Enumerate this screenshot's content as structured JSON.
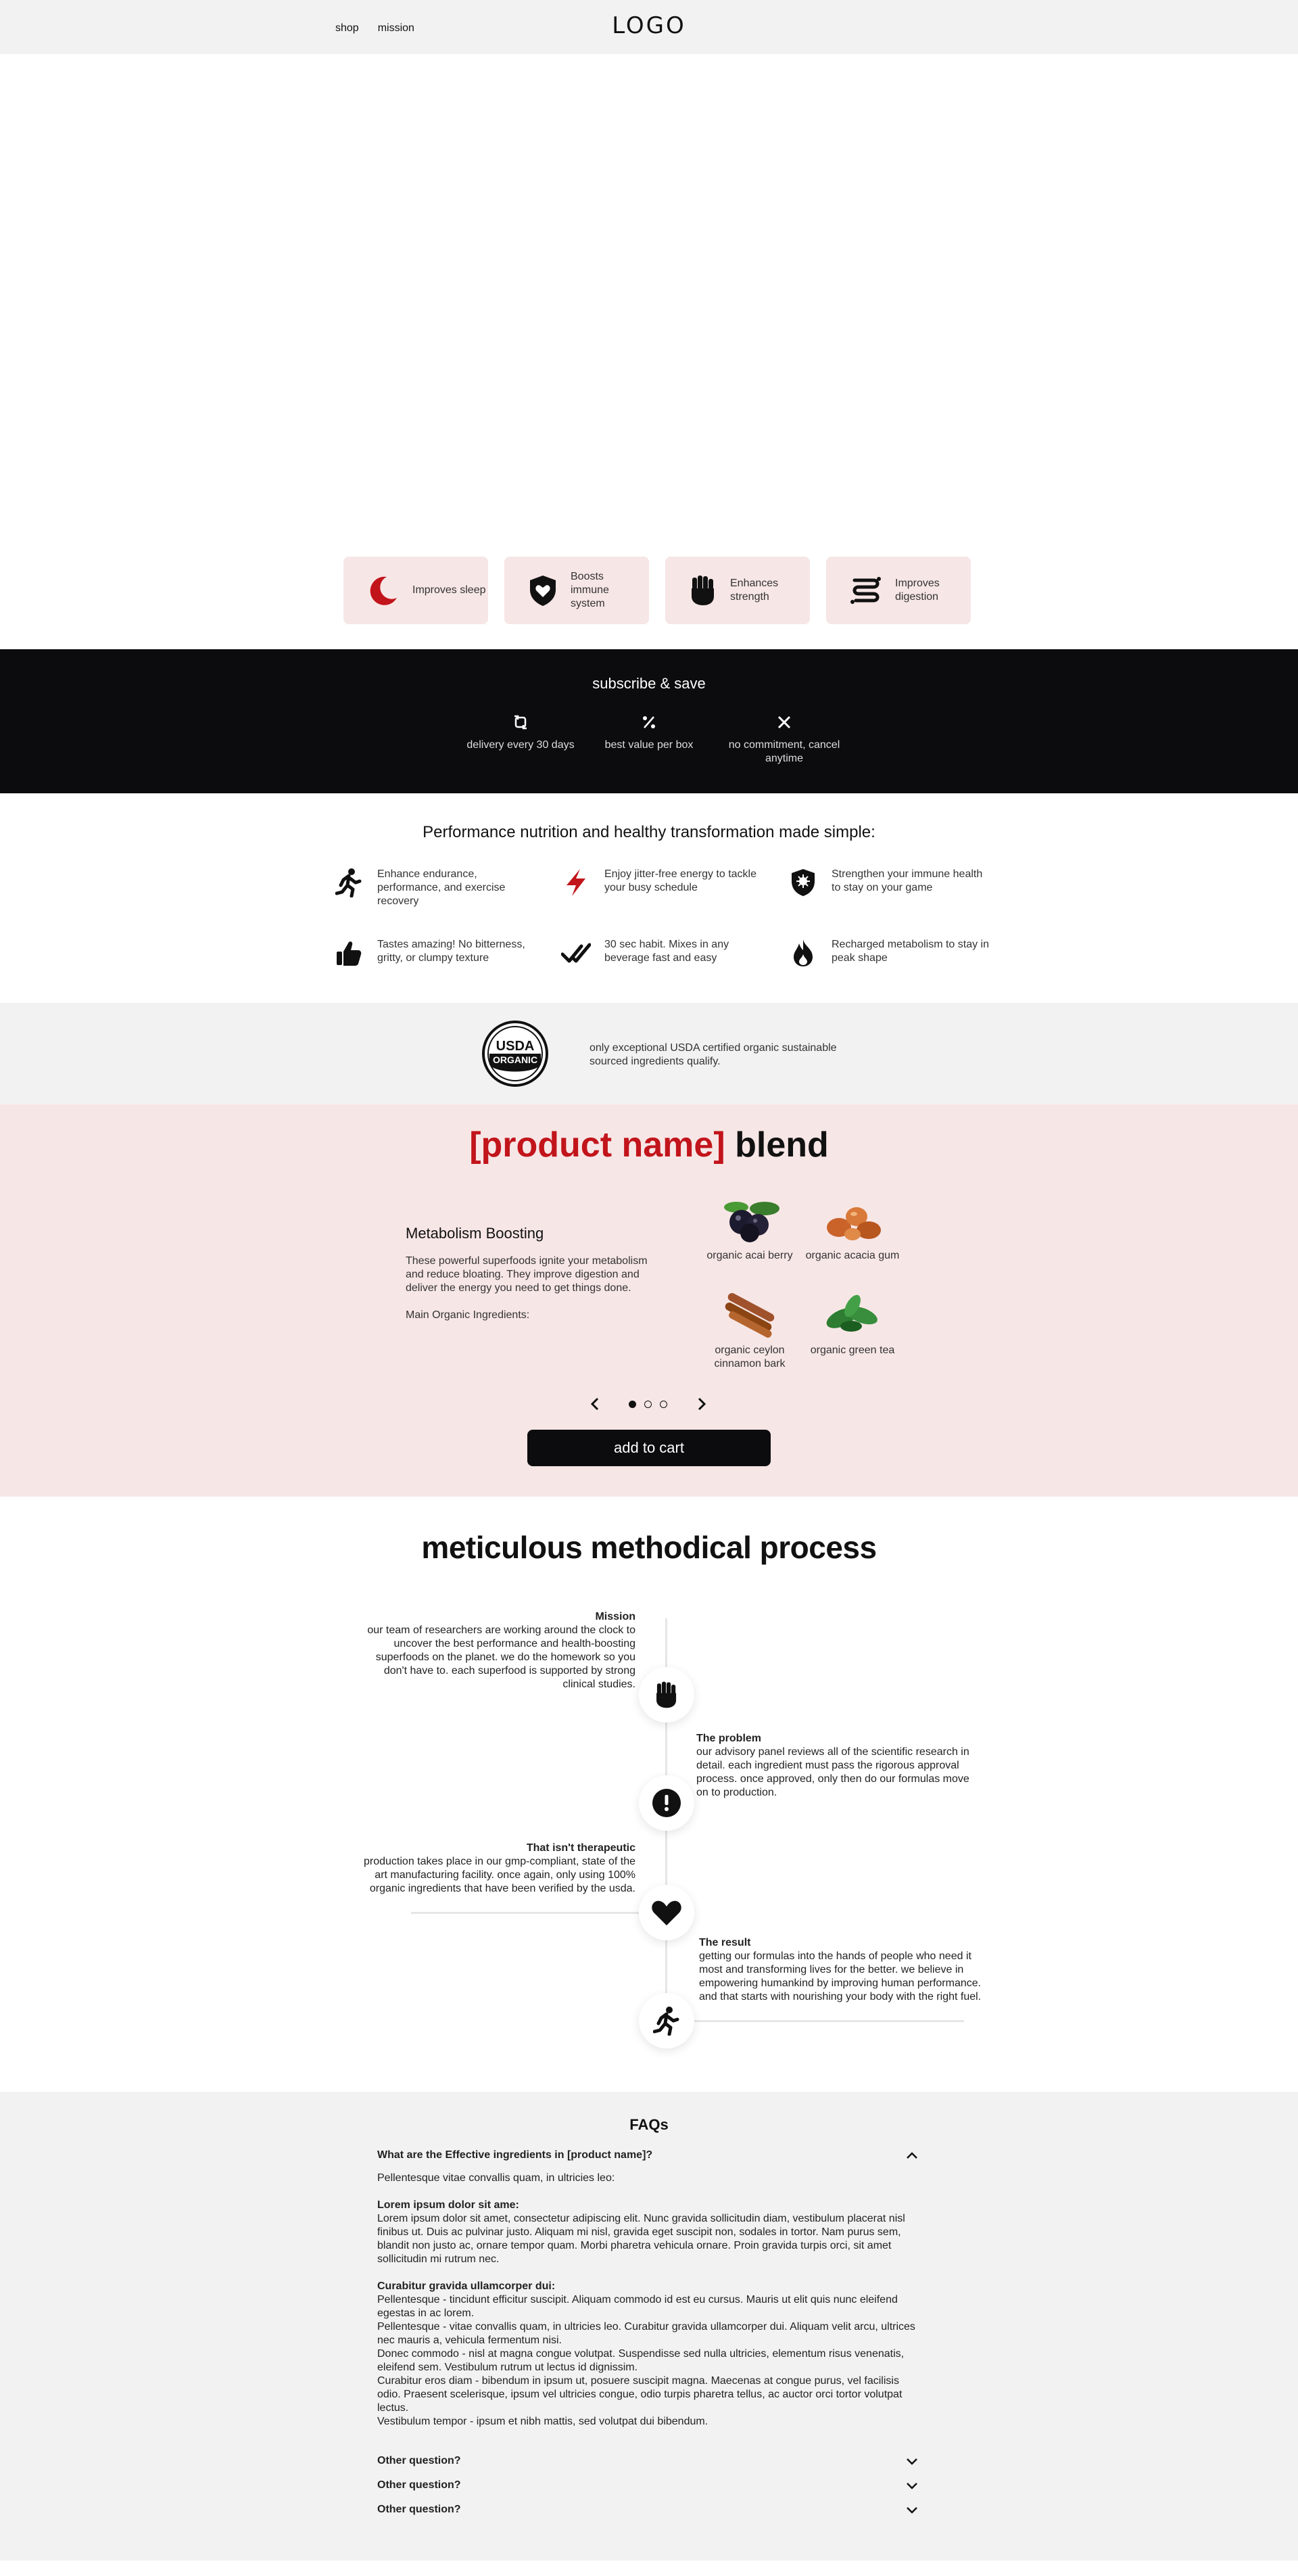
{
  "header": {
    "nav": [
      "shop",
      "mission"
    ],
    "logo": "LOGO"
  },
  "benefits": [
    {
      "icon": "moon-icon",
      "label": "Improves sleep"
    },
    {
      "icon": "shield-heart-icon",
      "label": "Boosts immune system"
    },
    {
      "icon": "fist-icon",
      "label": "Enhances strength"
    },
    {
      "icon": "stomach-icon",
      "label": "Improves digestion"
    }
  ],
  "subscribe": {
    "title": "subscribe & save",
    "items": [
      {
        "icon": "recycle-icon",
        "label": "delivery every 30 days"
      },
      {
        "icon": "percent-icon",
        "label": "best value per box"
      },
      {
        "icon": "close-icon",
        "label": "no commitment, cancel anytime"
      }
    ]
  },
  "performance": {
    "title": "Performance nutrition and healthy transformation made simple:",
    "items": [
      {
        "icon": "running-icon",
        "text": "Enhance endurance, performance, and exercise recovery"
      },
      {
        "icon": "lightning-icon",
        "text": "Enjoy jitter-free energy to tackle your busy schedule"
      },
      {
        "icon": "shield-virus-icon",
        "text": "Strengthen your immune health to stay on your game"
      },
      {
        "icon": "thumbs-up-icon",
        "text": "Tastes amazing! No bitterness, gritty, or clumpy texture"
      },
      {
        "icon": "double-check-icon",
        "text": "30 sec habit. Mixes in any beverage fast and easy"
      },
      {
        "icon": "flame-icon",
        "text": "Recharged metabolism to stay in peak shape"
      }
    ]
  },
  "usda": {
    "seal_top": "USDA",
    "seal_bottom": "ORGANIC",
    "text": "only exceptional USDA certified organic sustainable sourced ingredients qualify."
  },
  "blend": {
    "title_red": "[product name]",
    "title_black": "blend",
    "subtitle": "Metabolism Boosting",
    "description": "These powerful superfoods ignite your metabolism and reduce bloating. They improve digestion and deliver the energy you need to get things done.",
    "ingredients_label": "Main Organic Ingredients:",
    "ingredients": [
      {
        "icon": "acai-berry-icon",
        "label": "organic acai berry"
      },
      {
        "icon": "acacia-gum-icon",
        "label": "organic acacia gum"
      },
      {
        "icon": "cinnamon-icon",
        "label": "organic ceylon cinnamon bark"
      },
      {
        "icon": "green-tea-icon",
        "label": "organic green tea"
      }
    ],
    "add_to_cart": "add to cart"
  },
  "process": {
    "title": "meticulous methodical process",
    "steps": [
      {
        "icon": "fist-icon",
        "title": "Mission",
        "text": "our team of researchers are working around the clock to uncover the best performance and health-boosting superfoods on the planet. we do the homework so you don't have to. each superfood is supported by strong clinical studies."
      },
      {
        "icon": "alert-icon",
        "title": "The problem",
        "text": "our advisory panel reviews all of the scientific research in detail. each ingredient must pass the rigorous approval process. once approved, only then do our formulas move on to production."
      },
      {
        "icon": "heart-icon",
        "title": "That isn't therapeutic",
        "text": "production takes place in our gmp-compliant, state of the art manufacturing facility. once again, only using 100% organic ingredients that have been verified by the usda."
      },
      {
        "icon": "running-icon",
        "title": "The result",
        "text": "getting our formulas into the hands of people who need it most and transforming lives for the better. we believe in empowering humankind by improving human performance. and that starts with nourishing your body with the right fuel."
      }
    ]
  },
  "faq": {
    "title": "FAQs",
    "open_question": "What are the Effective ingredients in [product name]?",
    "intro": "Pellentesque vitae convallis quam, in ultricies leo:",
    "block1_title": "Lorem ipsum dolor sit ame:",
    "block1_text": "Lorem ipsum dolor sit amet, consectetur adipiscing elit. Nunc gravida sollicitudin diam, vestibulum placerat nisl finibus ut. Duis ac pulvinar justo. Aliquam mi nisl, gravida eget suscipit non, sodales in tortor. Nam purus sem, blandit non justo ac, ornare tempor quam. Morbi pharetra vehicula ornare. Proin gravida turpis orci, sit amet sollicitudin mi rutrum nec.",
    "block2_title": "Curabitur gravida ullamcorper dui:",
    "block2_lines": [
      "Pellentesque - tincidunt efficitur suscipit. Aliquam commodo id est eu cursus. Mauris ut elit quis nunc eleifend egestas in ac lorem.",
      "Pellentesque - vitae convallis quam, in ultricies leo. Curabitur gravida ullamcorper dui. Aliquam velit arcu, ultrices nec mauris a, vehicula fermentum nisi.",
      "Donec commodo - nisl at magna congue volutpat. Suspendisse sed nulla ultricies, elementum risus venenatis, eleifend sem. Vestibulum rutrum ut lectus id dignissim.",
      "Curabitur eros diam - bibendum in ipsum ut, posuere suscipit magna. Maecenas at congue purus, vel facilisis odio. Praesent scelerisque, ipsum vel ultricies congue, odio turpis pharetra tellus, ac auctor orci tortor volutpat lectus.",
      "Vestibulum tempor - ipsum et nibh mattis, sed volutpat dui bibendum."
    ],
    "other_questions": [
      "Other question?",
      "Other question?",
      "Other question?"
    ]
  }
}
